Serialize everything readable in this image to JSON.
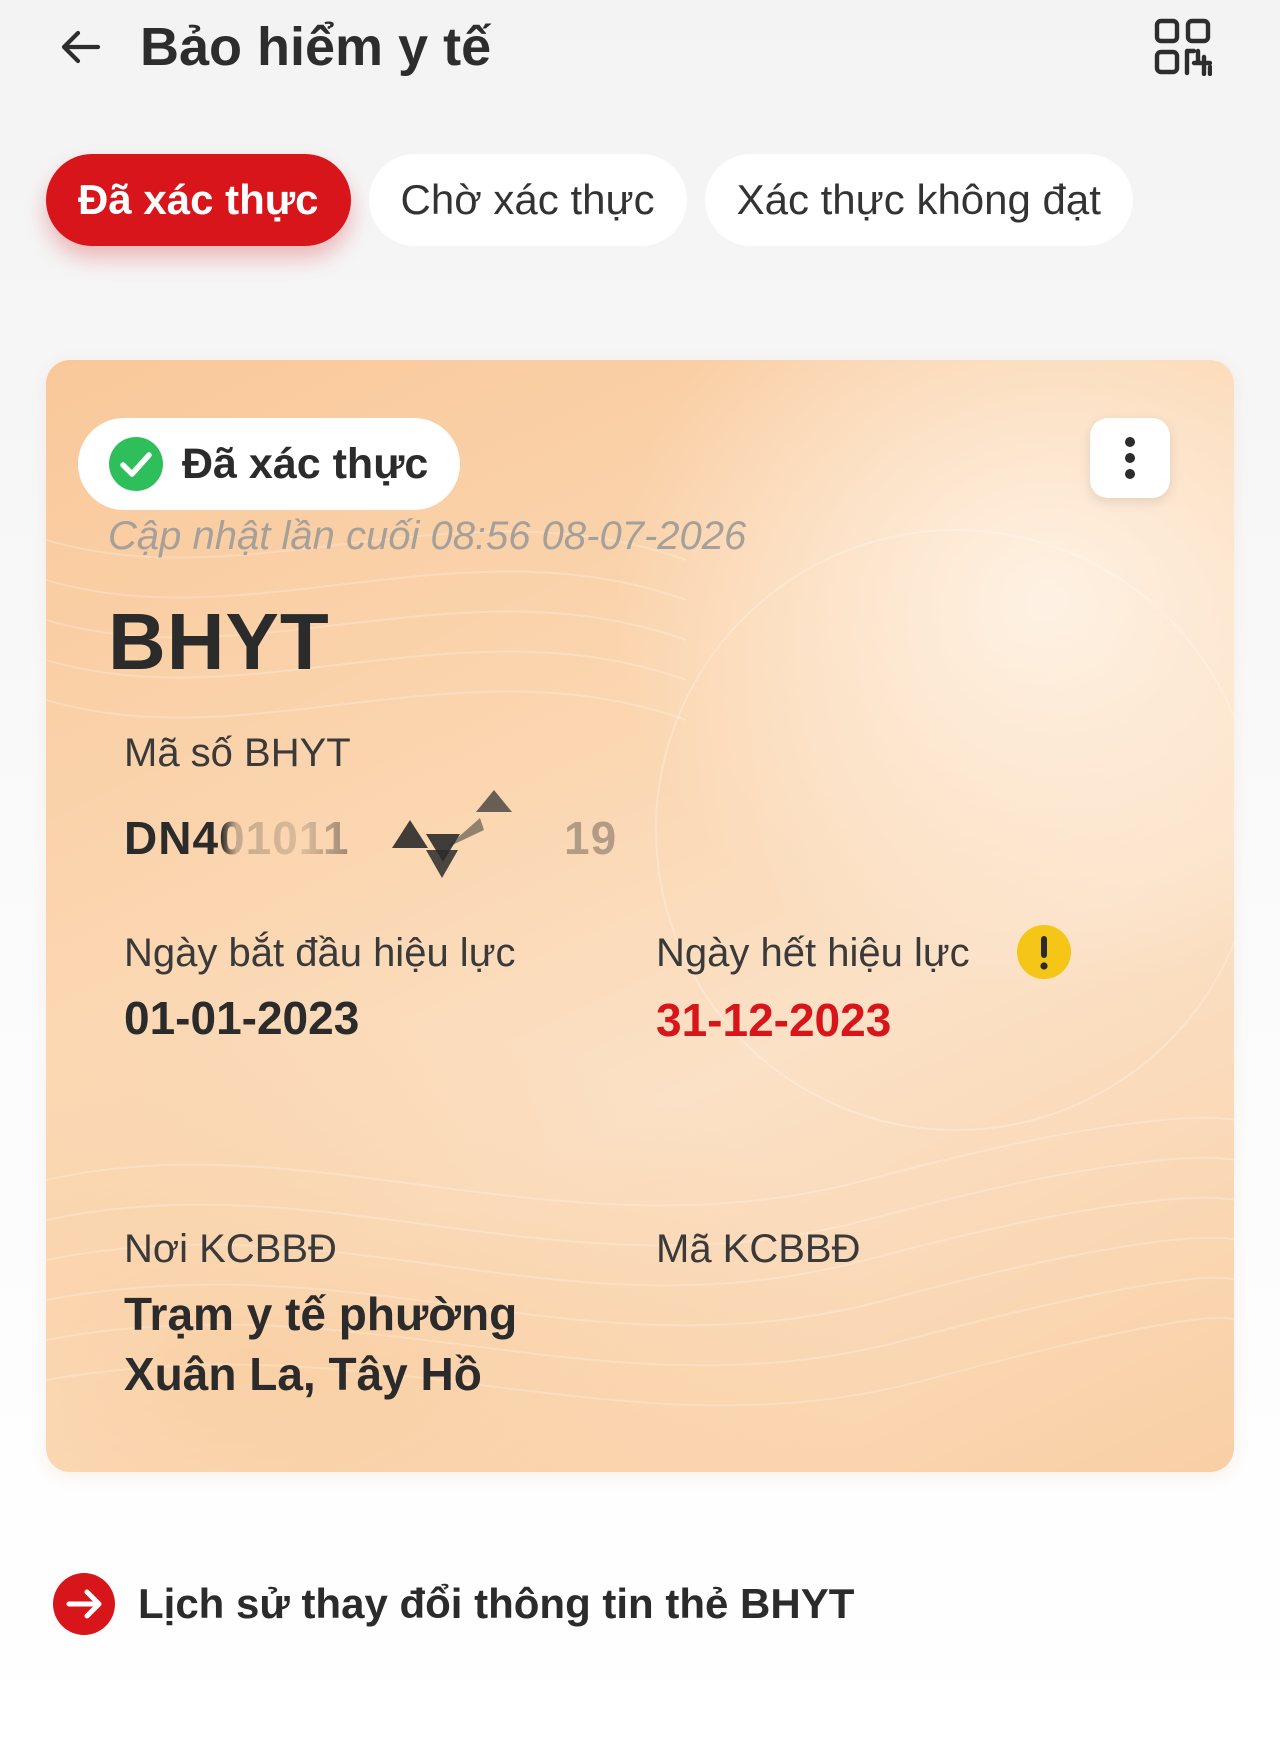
{
  "header": {
    "title": "Bảo hiểm y tế",
    "back_icon": "arrow-left-icon",
    "qr_icon": "qr-code-icon"
  },
  "tabs": [
    {
      "label": "Đã xác thực",
      "active": true
    },
    {
      "label": "Chờ xác thực",
      "active": false
    },
    {
      "label": "Xác thực không đạt",
      "active": false
    }
  ],
  "card": {
    "status": "Đã xác thực",
    "status_icon": "check-circle-icon",
    "status_color": "#2fbf5a",
    "more_icon": "more-vertical-icon",
    "updated": "Cập nhật lần cuối 08:56 08-07-2026",
    "type": "BHYT",
    "code_label": "Mã số BHYT",
    "code_value": "DN401011",
    "code_value_tail": "19",
    "start_label": "Ngày bắt đầu hiệu lực",
    "start_value": "01-01-2023",
    "end_label": "Ngày hết hiệu lực",
    "end_value": "31-12-2023",
    "end_warning_icon": "warning-icon",
    "warning_color": "#f5c518",
    "place_label": "Nơi KCBBĐ",
    "place_value": "Trạm y tế phường Xuân La, Tây Hồ",
    "place_code_label": "Mã KCBBĐ",
    "place_code_value": ""
  },
  "history": {
    "label": "Lịch sử thay đổi thông tin thẻ BHYT",
    "icon": "arrow-right-circle-icon"
  },
  "colors": {
    "accent": "#d8151b",
    "card_orange": "#f9c89a",
    "text_dark": "#2b2b2b",
    "muted": "#a6a09a"
  }
}
